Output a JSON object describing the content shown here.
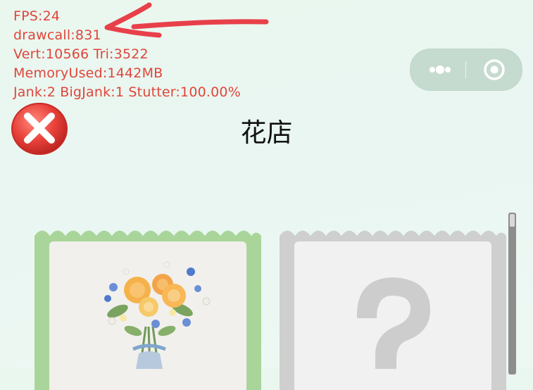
{
  "debug_stats": {
    "fps": "FPS:24",
    "drawcall": "drawcall:831",
    "vert_tri": "Vert:10566 Tri:3522",
    "memory": "MemoryUsed:1442MB",
    "jank": "Jank:2 BigJank:1 Stutter:100.00%"
  },
  "header": {
    "title": "花店"
  },
  "capsule": {
    "more_icon": "more-dots-icon",
    "close_icon": "target-circle-icon"
  },
  "close_button": {
    "icon": "red-x-icon"
  },
  "cards": [
    {
      "state": "unlocked",
      "frame_color": "#a9d59a",
      "image": "flower-bouquet"
    },
    {
      "state": "locked",
      "frame_color": "#cfcfcf",
      "image": "question-mark-icon"
    }
  ],
  "colors": {
    "stats_text": "#e0453a",
    "annotation_arrow": "#e8404a"
  }
}
